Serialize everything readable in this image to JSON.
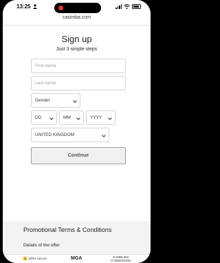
{
  "status_bar": {
    "time": "13:25",
    "icons": [
      "person-icon",
      "record-dot-icon",
      "signal-icon",
      "wifi-icon",
      "battery-icon"
    ]
  },
  "browser": {
    "url": "casimba.com"
  },
  "signup": {
    "title": "Sign up",
    "subtitle": "Just 3 simple steps",
    "first_name_placeholder": "First name",
    "last_name_placeholder": "Last name",
    "gender_value": "Gender",
    "dob_day": "DD",
    "dob_month": "MM",
    "dob_year": "YYYY",
    "country_value": "UNITED KINGDOM",
    "continue_label": "Continue"
  },
  "promo": {
    "title": "Promotional Terms & Conditions",
    "offer_heading": "Details of the offer"
  },
  "footer": {
    "secure_label": "100% Secure",
    "mga_label": "MGA",
    "gc_line1": "GAMBLING",
    "gc_line2": "COMMISSION"
  }
}
